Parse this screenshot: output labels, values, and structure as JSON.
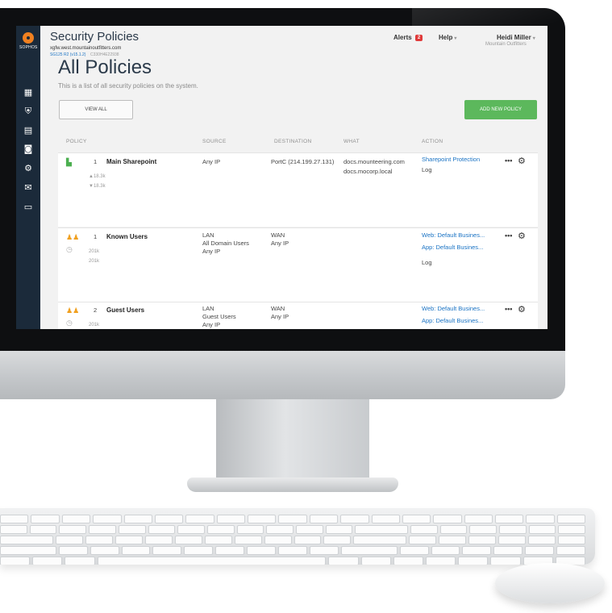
{
  "app": {
    "title": "Security Policies",
    "device_host": "xgfw.west.mountainoutfitters.com",
    "device_version": "SG125 R2 (v15.1.2)",
    "device_serial": "C330H4E22938"
  },
  "logo": {
    "text": "SOPHOS"
  },
  "header": {
    "alerts_label": "Alerts",
    "alerts_count": "2",
    "help_label": "Help",
    "user_name": "Heidi Miller",
    "user_org": "Mountain Outfitters"
  },
  "page": {
    "title": "All Policies",
    "subtitle": "This is a list of all security  policies on the system.",
    "view_all_label": "VIEW ALL",
    "add_policy_label": "ADD NEW POLICY"
  },
  "columns": {
    "policy": "POLICY",
    "source": "SOURCE",
    "destination": "DESTINATION",
    "what": "WHAT",
    "action": "ACTION"
  },
  "policies": [
    {
      "number": "1",
      "name": "Main Sharepoint",
      "up_stat": "▲18.3k",
      "down_stat": "▼18.3k",
      "source": "Any IP",
      "destination": "PortC (214.199.27.131)",
      "what_1": "docs.mounteering.com",
      "what_2": "docs.mocorp.local",
      "action_link_1": "Sharepoint Protection",
      "action_log": "Log"
    },
    {
      "number": "1",
      "name": "Known Users",
      "stat_1": "201k",
      "stat_2": "201k",
      "source_1": "LAN",
      "source_2": "All Domain Users",
      "source_3": "Any IP",
      "destination_1": "WAN",
      "destination_2": "Any IP",
      "action_link_1": "Web: Default Busines...",
      "action_link_2": "App: Default Busines...",
      "action_log": "Log"
    },
    {
      "number": "2",
      "name": "Guest Users",
      "stat_1": "201k",
      "source_1": "LAN",
      "source_2": "Guest Users",
      "source_3": "Any IP",
      "destination_1": "WAN",
      "destination_2": "Any IP",
      "action_link_1": "Web: Default Busines...",
      "action_link_2": "App: Default Busines..."
    }
  ],
  "icons": {
    "sidebar": [
      "monitor-icon",
      "shield-icon",
      "document-icon",
      "camera-icon",
      "gear-icon",
      "mail-icon",
      "server-icon"
    ],
    "row_actions": [
      "more-icon",
      "gear-icon"
    ]
  },
  "colors": {
    "sidebar_bg": "#1b2a3a",
    "brand_orange": "#f08020",
    "add_button_green": "#5cb85c",
    "link_blue": "#1a73c4",
    "alert_red": "#e03a3a"
  }
}
